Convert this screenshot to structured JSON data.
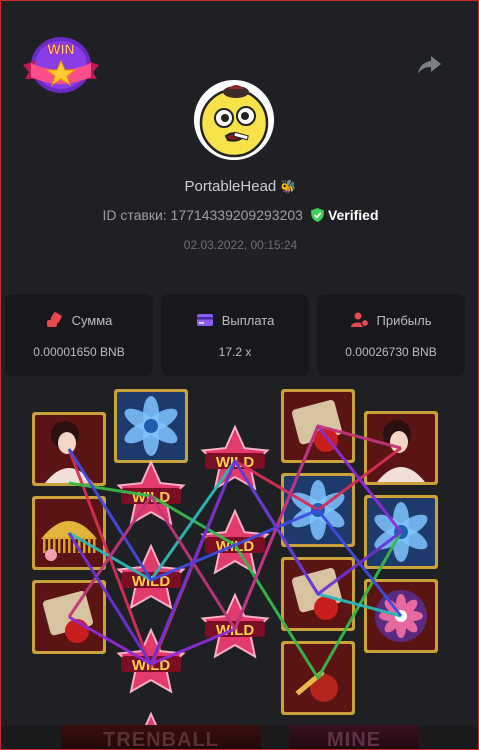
{
  "badge": {
    "text": "WIN",
    "icon": "star-icon"
  },
  "user": {
    "name": "PortableHead",
    "emoji": "🐝"
  },
  "bet": {
    "id_label": "ID ставки: 17714339209293203",
    "verified": "Verified"
  },
  "date": "02.03.2022, 00:15:24",
  "stats": [
    {
      "title": "Сумма",
      "value": "0.00001650 BNB",
      "icon": "coins-icon",
      "color": "#e5484d"
    },
    {
      "title": "Выплата",
      "value": "17.2 x",
      "icon": "card-icon",
      "color": "#8b5cf6"
    },
    {
      "title": "Прибыль",
      "value": "0.00026730 BNB",
      "icon": "user-money-icon",
      "color": "#e5484d"
    }
  ],
  "board": {
    "reels": [
      [
        "geisha",
        "comb",
        "lantern"
      ],
      [
        "lotus"
      ],
      [
        "wild",
        "wild",
        "wild",
        "wild"
      ],
      [
        "wild",
        "wild",
        "wild"
      ],
      [
        "lantern",
        "lotus",
        "lantern",
        "shamisen"
      ],
      [
        "geisha",
        "lotus",
        "fan"
      ]
    ],
    "wild_text": "WILD",
    "line_colors": [
      "#d72c55",
      "#36b84a",
      "#2cb7b7",
      "#8e2bd8",
      "#3f4be0",
      "#c0357a",
      "#6b30d6"
    ]
  },
  "footer": {
    "left": "TRENBALL",
    "right": "MINE"
  }
}
